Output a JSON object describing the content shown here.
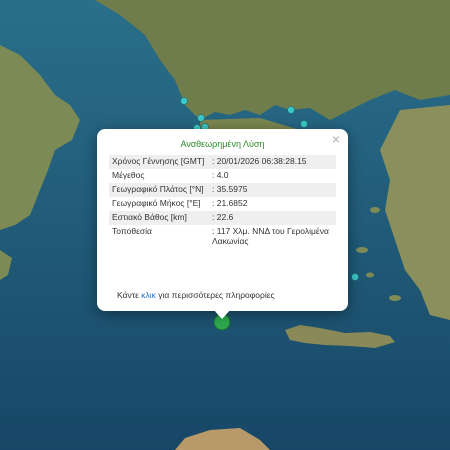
{
  "popup": {
    "title": "Αναθεωρημένη Λύση",
    "close_symbol": "×",
    "rows": [
      {
        "key": "Χρόνος Γέννησης [GMT]",
        "value": ": 20/01/2026 06:38:28.15"
      },
      {
        "key": "Μέγεθος",
        "value": ": 4.0"
      },
      {
        "key": "Γεωγραφικό Πλάτος [°N]",
        "value": ": 35.5975"
      },
      {
        "key": "Γεωγραφικό Μήκος [°E]",
        "value": ": 21.6852"
      },
      {
        "key": "Εστιακό Βάθος [km]",
        "value": ": 22.6"
      },
      {
        "key": "Τοποθεσία",
        "value": ": 117 Χλμ. ΝΝΔ του Γερολιμένα Λακωνίας"
      }
    ],
    "more_prefix": "Κάντε ",
    "more_link": "κλικ",
    "more_suffix": " για περισσότερες πληροφορίες"
  },
  "colors": {
    "sea": "#1f5a78",
    "land": "#7f8b55",
    "selected_marker": "#2ea84e",
    "event_marker": "#3cc6c8"
  }
}
